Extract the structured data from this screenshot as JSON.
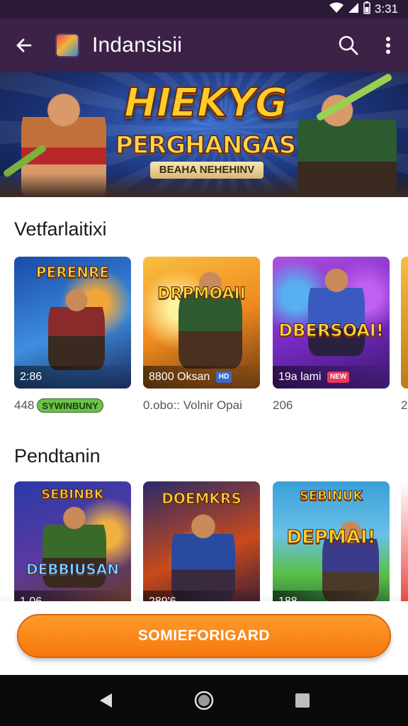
{
  "status_bar": {
    "time": "3:31"
  },
  "app_bar": {
    "title": "Indansisii"
  },
  "banner": {
    "title": "HIEKYG",
    "subtitle": "PERGHANGAS",
    "tagline": "BEAHA NEHEHINV"
  },
  "sections": [
    {
      "title": "Vetfarlaitixi",
      "cards": [
        {
          "art_title": "PERENRE",
          "badge": "2:86",
          "badge_tag": "",
          "colors": [
            "#1a4aa8",
            "#3e8ee0",
            "#f2a63a"
          ]
        },
        {
          "art_title": "DRPMOAII",
          "badge": "8800 Oksan",
          "badge_tag": "HD",
          "colors": [
            "#f08a1e",
            "#f8c040",
            "#6a3a12"
          ]
        },
        {
          "art_title": "DBERSOAI!",
          "badge": "19a lami",
          "badge_tag": "NEW",
          "colors": [
            "#7a2ac8",
            "#b050e0",
            "#3a1a6a"
          ]
        }
      ],
      "meta": [
        {
          "text": "448",
          "chip": "SYWINBUNY"
        },
        {
          "text": "0.obo::   Volnir Opai",
          "chip": ""
        },
        {
          "text": "206",
          "chip": ""
        },
        {
          "text": "2",
          "chip": ""
        }
      ]
    },
    {
      "title": "Pendtanin",
      "cards": [
        {
          "art_title": "SEBINBK",
          "badge": "1.06",
          "sub_title": "DEBBIUSAN",
          "colors": [
            "#2a3aa8",
            "#e8a030",
            "#6a3a1a"
          ]
        },
        {
          "art_title": "DOEMKRS",
          "badge": "289'6",
          "sub_title": "",
          "colors": [
            "#c84a1a",
            "#2a2a6a",
            "#f0a030"
          ]
        },
        {
          "art_title": "SEBINUK",
          "badge": "188",
          "sub_title": "DEPMAI!",
          "colors": [
            "#3aa0d8",
            "#5ac048",
            "#2a6a3a"
          ]
        }
      ]
    }
  ],
  "cta": {
    "label": "SOMIEFORIGARD"
  },
  "icons": {
    "back": "arrow-left-icon",
    "search": "search-icon",
    "more": "more-vertical-icon",
    "nav_back": "nav-back-icon",
    "nav_home": "nav-home-icon",
    "nav_recents": "nav-recents-icon"
  },
  "colors": {
    "app_bar": "#3c2246",
    "status_bar": "#2a1a38",
    "cta": "#f5780e",
    "nav_bar": "#0a0a0a"
  }
}
